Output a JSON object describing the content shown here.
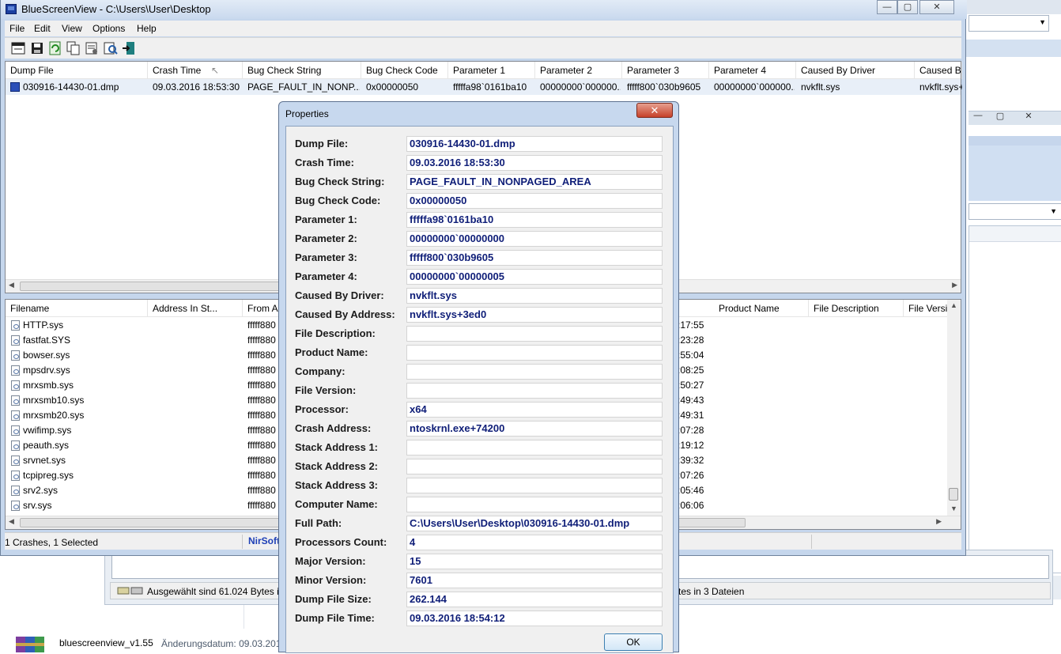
{
  "main_window": {
    "title": "BlueScreenView  -  C:\\Users\\User\\Desktop",
    "controls": {
      "minimize": "—",
      "maximize": "▢",
      "close": "✕"
    }
  },
  "menu": [
    "File",
    "Edit",
    "View",
    "Options",
    "Help"
  ],
  "toolbar_icons": [
    "save-html-icon",
    "save-icon",
    "refresh-icon",
    "copy-icon",
    "properties-icon",
    "find-icon",
    "exit-icon"
  ],
  "crash_list": {
    "columns": [
      "Dump File",
      "Crash Time",
      "Bug Check String",
      "Bug Check Code",
      "Parameter 1",
      "Parameter 2",
      "Parameter 3",
      "Parameter 4",
      "Caused By Driver",
      "Caused By"
    ],
    "sort_indicator": "↖",
    "rows": [
      {
        "dump_file": "030916-14430-01.dmp",
        "crash_time": "09.03.2016 18:53:30",
        "bug_check_string": "PAGE_FAULT_IN_NONP...",
        "bug_check_code": "0x00000050",
        "param1": "fffffa98`0161ba10",
        "param2": "00000000`000000...",
        "param3": "fffff800`030b9605",
        "param4": "00000000`000000...",
        "caused_by_driver": "nvkflt.sys",
        "caused_by": "nvkflt.sys+"
      }
    ]
  },
  "driver_list": {
    "columns": [
      "Filename",
      "Address In St...",
      "From Ad",
      "Product Name",
      "File Description",
      "File Versi"
    ],
    "rows": [
      {
        "name": "HTTP.sys",
        "addr": "fffff880",
        "time": ":17:55"
      },
      {
        "name": "fastfat.SYS",
        "addr": "fffff880",
        "time": ":23:28"
      },
      {
        "name": "bowser.sys",
        "addr": "fffff880",
        "time": ":55:04"
      },
      {
        "name": "mpsdrv.sys",
        "addr": "fffff880",
        "time": ":08:25"
      },
      {
        "name": "mrxsmb.sys",
        "addr": "fffff880",
        "time": ":50:27"
      },
      {
        "name": "mrxsmb10.sys",
        "addr": "fffff880",
        "time": ":49:43"
      },
      {
        "name": "mrxsmb20.sys",
        "addr": "fffff880",
        "time": ":49:31"
      },
      {
        "name": "vwifimp.sys",
        "addr": "fffff880",
        "time": ":07:28"
      },
      {
        "name": "peauth.sys",
        "addr": "fffff880",
        "time": ":19:12"
      },
      {
        "name": "srvnet.sys",
        "addr": "fffff880",
        "time": ":39:32"
      },
      {
        "name": "tcpipreg.sys",
        "addr": "fffff880",
        "time": ":07:26"
      },
      {
        "name": "srv2.sys",
        "addr": "fffff880",
        "time": ":05:46"
      },
      {
        "name": "srv.sys",
        "addr": "fffff880",
        "time": ":06:06"
      }
    ]
  },
  "status": {
    "summary": "1 Crashes, 1 Selected",
    "brand": "NirSoft"
  },
  "background_explorer": {
    "status_left": "Ausgewählt sind 61.024 Bytes in",
    "status_right": "ytes in 3 Dateien",
    "file_name": "bluescreenview_v1.55",
    "file_meta": "Änderungsdatum: 09.03.201"
  },
  "properties_dialog": {
    "title": "Properties",
    "close": "✕",
    "ok_label": "OK",
    "fields": [
      {
        "label": "Dump File:",
        "value": "030916-14430-01.dmp"
      },
      {
        "label": "Crash Time:",
        "value": "09.03.2016 18:53:30"
      },
      {
        "label": "Bug Check String:",
        "value": "PAGE_FAULT_IN_NONPAGED_AREA"
      },
      {
        "label": "Bug Check Code:",
        "value": "0x00000050"
      },
      {
        "label": "Parameter 1:",
        "value": "fffffa98`0161ba10"
      },
      {
        "label": "Parameter 2:",
        "value": "00000000`00000000"
      },
      {
        "label": "Parameter 3:",
        "value": "fffff800`030b9605"
      },
      {
        "label": "Parameter 4:",
        "value": "00000000`00000005"
      },
      {
        "label": "Caused By Driver:",
        "value": "nvkflt.sys"
      },
      {
        "label": "Caused By Address:",
        "value": "nvkflt.sys+3ed0"
      },
      {
        "label": "File Description:",
        "value": ""
      },
      {
        "label": "Product Name:",
        "value": ""
      },
      {
        "label": "Company:",
        "value": ""
      },
      {
        "label": "File Version:",
        "value": ""
      },
      {
        "label": "Processor:",
        "value": "x64"
      },
      {
        "label": "Crash Address:",
        "value": "ntoskrnl.exe+74200"
      },
      {
        "label": "Stack Address 1:",
        "value": ""
      },
      {
        "label": "Stack Address 2:",
        "value": ""
      },
      {
        "label": "Stack Address 3:",
        "value": ""
      },
      {
        "label": "Computer Name:",
        "value": ""
      },
      {
        "label": "Full Path:",
        "value": "C:\\Users\\User\\Desktop\\030916-14430-01.dmp"
      },
      {
        "label": "Processors Count:",
        "value": "4"
      },
      {
        "label": "Major Version:",
        "value": "15"
      },
      {
        "label": "Minor Version:",
        "value": "7601"
      },
      {
        "label": "Dump File Size:",
        "value": "262.144"
      },
      {
        "label": "Dump File Time:",
        "value": "09.03.2016 18:54:12"
      }
    ]
  }
}
